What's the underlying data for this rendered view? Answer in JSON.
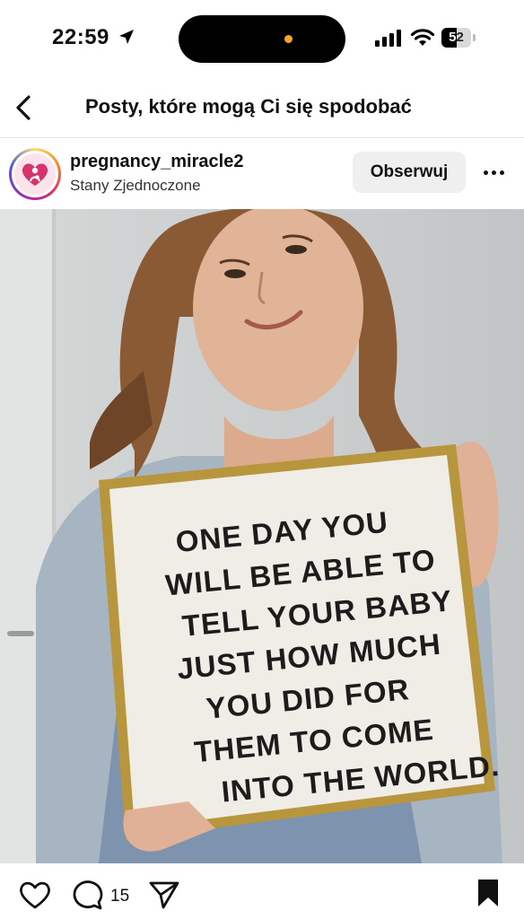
{
  "status_bar": {
    "time": "22:59",
    "battery": "52",
    "battery_level": 0.52
  },
  "header": {
    "title": "Posty, które mogą Ci się spodobać"
  },
  "post": {
    "username": "pregnancy_miracle2",
    "location": "Stany Zjednoczone",
    "follow_label": "Obserwuj",
    "image": {
      "board_lines": [
        "ONE DAY YOU",
        "WILL BE ABLE TO",
        "TELL YOUR BABY",
        "JUST HOW MUCH",
        "YOU DID FOR",
        "THEM TO COME",
        "INTO THE WORLD."
      ]
    },
    "comment_count": "15"
  },
  "icons": {
    "back": "chevron-left-icon",
    "more": "more-horizontal-icon",
    "like": "heart-icon",
    "comment": "comment-icon",
    "share": "send-icon",
    "save": "bookmark-icon"
  }
}
